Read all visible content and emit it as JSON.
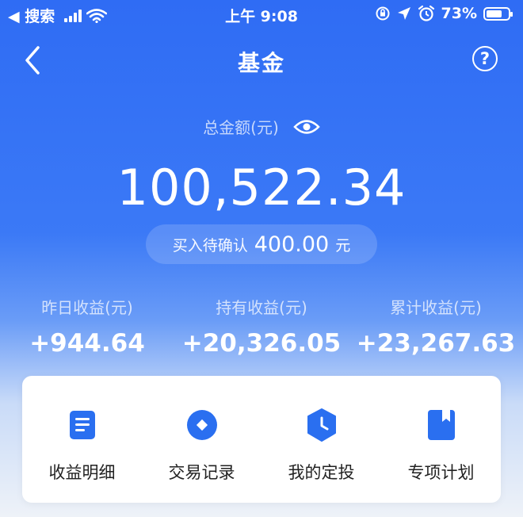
{
  "status_bar": {
    "back_app": "◀ 搜索",
    "time": "上午 9:08",
    "battery": "73%",
    "battery_level": 0.73
  },
  "nav": {
    "title": "基金",
    "help": "?"
  },
  "summary": {
    "total_label": "总金额(元)",
    "total_amount": "100,522.34",
    "pending_label": "买入待确认",
    "pending_amount": "400.00",
    "pending_unit": "元"
  },
  "stats": [
    {
      "label": "昨日收益(元)",
      "value": "+944.64"
    },
    {
      "label": "持有收益(元)",
      "value": "+20,326.05"
    },
    {
      "label": "累计收益(元)",
      "value": "+23,267.63"
    }
  ],
  "actions": [
    {
      "label": "收益明细",
      "icon": "document-icon"
    },
    {
      "label": "交易记录",
      "icon": "record-icon"
    },
    {
      "label": "我的定投",
      "icon": "clock-shield-icon"
    },
    {
      "label": "专项计划",
      "icon": "bookmark-icon"
    }
  ],
  "colors": {
    "accent": "#2f6cf4",
    "icon_blue": "#2a6ff0"
  }
}
